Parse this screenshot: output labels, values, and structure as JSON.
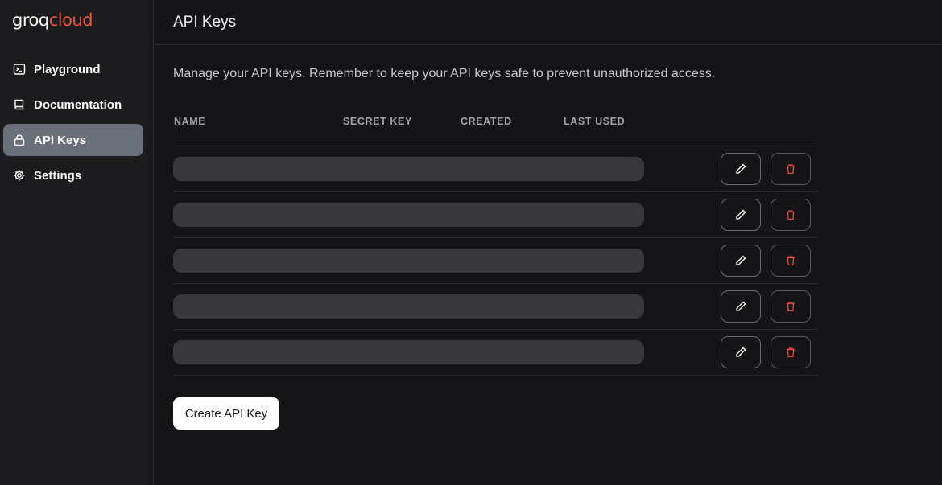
{
  "brand": {
    "part1": "groq",
    "part2": "cloud",
    "accent_color": "#e8553f"
  },
  "sidebar": {
    "items": [
      {
        "label": "Playground",
        "icon": "terminal-icon",
        "active": false
      },
      {
        "label": "Documentation",
        "icon": "book-icon",
        "active": false
      },
      {
        "label": "API Keys",
        "icon": "lock-icon",
        "active": true
      },
      {
        "label": "Settings",
        "icon": "gear-icon",
        "active": false
      }
    ]
  },
  "header": {
    "title": "API Keys"
  },
  "main": {
    "description": "Manage your API keys. Remember to keep your API keys safe to prevent unauthorized access.",
    "table": {
      "columns": [
        "NAME",
        "SECRET KEY",
        "CREATED",
        "LAST USED"
      ],
      "row_count": 5,
      "row_state": "loading"
    },
    "create_button_label": "Create API Key"
  },
  "colors": {
    "background": "#151518",
    "sidebar": "#1c1c1f",
    "active_nav": "#6b6f79",
    "skeleton": "#38383b",
    "delete_icon": "#e5484d"
  }
}
